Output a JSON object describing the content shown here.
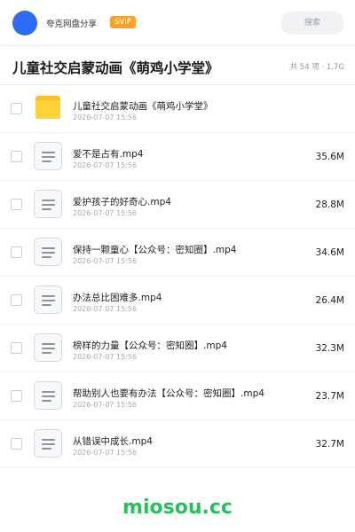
{
  "header": {
    "app_name": "夸克网盘分享",
    "badge": "SVIP",
    "search_placeholder": "搜索"
  },
  "folder": {
    "title": "儿童社交启蒙动画《萌鸡小学堂》",
    "meta": "共 54 项 · 1.7G"
  },
  "files": [
    {
      "type": "folder",
      "name": "儿童社交启蒙动画《萌鸡小学堂》",
      "date": "2026-07-07 15:56",
      "size": ""
    },
    {
      "type": "file",
      "name": "爱不是占有.mp4",
      "date": "2026-07-07 15:56",
      "size": "35.6M"
    },
    {
      "type": "file",
      "name": "爱护孩子的好奇心.mp4",
      "date": "2026-07-07 15:56",
      "size": "28.8M"
    },
    {
      "type": "file",
      "name": "保持一颗童心【公众号：密知圈】.mp4",
      "date": "2026-07-07 15:56",
      "size": "34.6M"
    },
    {
      "type": "file",
      "name": "办法总比困难多.mp4",
      "date": "2026-07-07 15:56",
      "size": "26.4M"
    },
    {
      "type": "file",
      "name": "榜样的力量【公众号：密知圈】.mp4",
      "date": "2026-07-07 15:56",
      "size": "32.3M"
    },
    {
      "type": "file",
      "name": "帮助别人也要有办法【公众号：密知圈】.mp4",
      "date": "2026-07-07 15:56",
      "size": "23.7M"
    },
    {
      "type": "file",
      "name": "从错误中成长.mp4",
      "date": "2026-07-07 15:56",
      "size": "32.7M"
    }
  ],
  "icons": {
    "folder": "folder-icon",
    "file": "document-icon",
    "avatar": "avatar"
  },
  "colors": {
    "avatar": "#2e6cf6",
    "badge": "#f7a226",
    "folder": "#ffd23a",
    "watermark": "#26c15a"
  },
  "watermark": "miosou.cc"
}
